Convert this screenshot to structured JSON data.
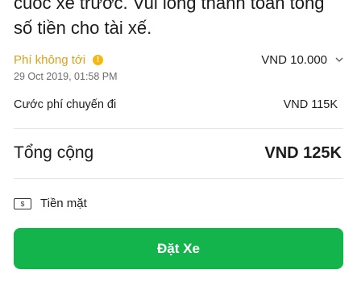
{
  "notice": {
    "line1": "cuốc xe trước. Vui lòng thanh toán tổng",
    "line2": "số tiền cho tài xế."
  },
  "no_fee": {
    "label": "Phí không tới",
    "info_glyph": "!",
    "amount": "VND 10.000",
    "timestamp": "29 Oct 2019, 01:58 PM"
  },
  "trip_fare": {
    "label": "Cước phí chuyến đi",
    "amount": "VND 115K"
  },
  "total": {
    "label": "Tổng cộng",
    "amount": "VND 125K"
  },
  "payment": {
    "icon_glyph": "$",
    "method": "Tiền mặt"
  },
  "book_button": {
    "label": "Đặt Xe"
  },
  "colors": {
    "accent_green": "#12b44b",
    "warning_yellow": "#d9a21b"
  }
}
